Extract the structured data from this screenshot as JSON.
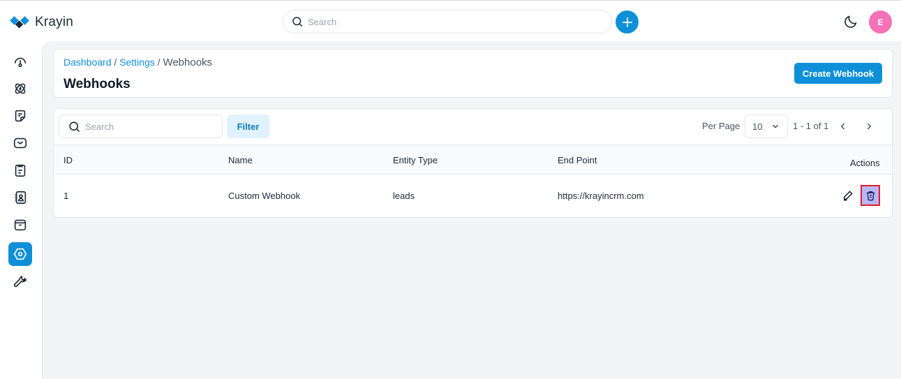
{
  "app": {
    "name": "Krayin"
  },
  "header": {
    "search_placeholder": "Search",
    "avatar_initial": "E"
  },
  "sidebar": {
    "items": [
      {
        "name": "dashboard",
        "icon": "gauge-icon",
        "active": false
      },
      {
        "name": "leads",
        "icon": "atom-icon",
        "active": false
      },
      {
        "name": "quotes",
        "icon": "note-icon",
        "active": false
      },
      {
        "name": "mail",
        "icon": "mail-icon",
        "active": false
      },
      {
        "name": "activities",
        "icon": "clipboard-icon",
        "active": false
      },
      {
        "name": "contacts",
        "icon": "contact-book-icon",
        "active": false
      },
      {
        "name": "products",
        "icon": "archive-box-icon",
        "active": false
      },
      {
        "name": "settings",
        "icon": "hexagon-settings-icon",
        "active": true
      },
      {
        "name": "configuration",
        "icon": "wrench-icon",
        "active": false
      }
    ]
  },
  "page": {
    "breadcrumb": [
      "Dashboard",
      "Settings",
      "Webhooks"
    ],
    "breadcrumb_sep": "/",
    "title": "Webhooks",
    "create_label": "Create Webhook"
  },
  "toolbar": {
    "search_placeholder": "Search",
    "filter_label": "Filter",
    "per_page_label": "Per Page",
    "per_page_value": "10",
    "page_info": "1 - 1 of 1"
  },
  "table": {
    "columns": [
      "ID",
      "Name",
      "Entity Type",
      "End Point",
      "Actions"
    ],
    "rows": [
      {
        "id": "1",
        "name": "Custom Webhook",
        "entity_type": "leads",
        "end_point": "https://krayincrm.com"
      }
    ]
  },
  "colors": {
    "accent": "#0e90d9",
    "avatar": "#f472b6",
    "delete_highlight": "#b9b7ff",
    "delete_outline": "#e11d2a"
  }
}
